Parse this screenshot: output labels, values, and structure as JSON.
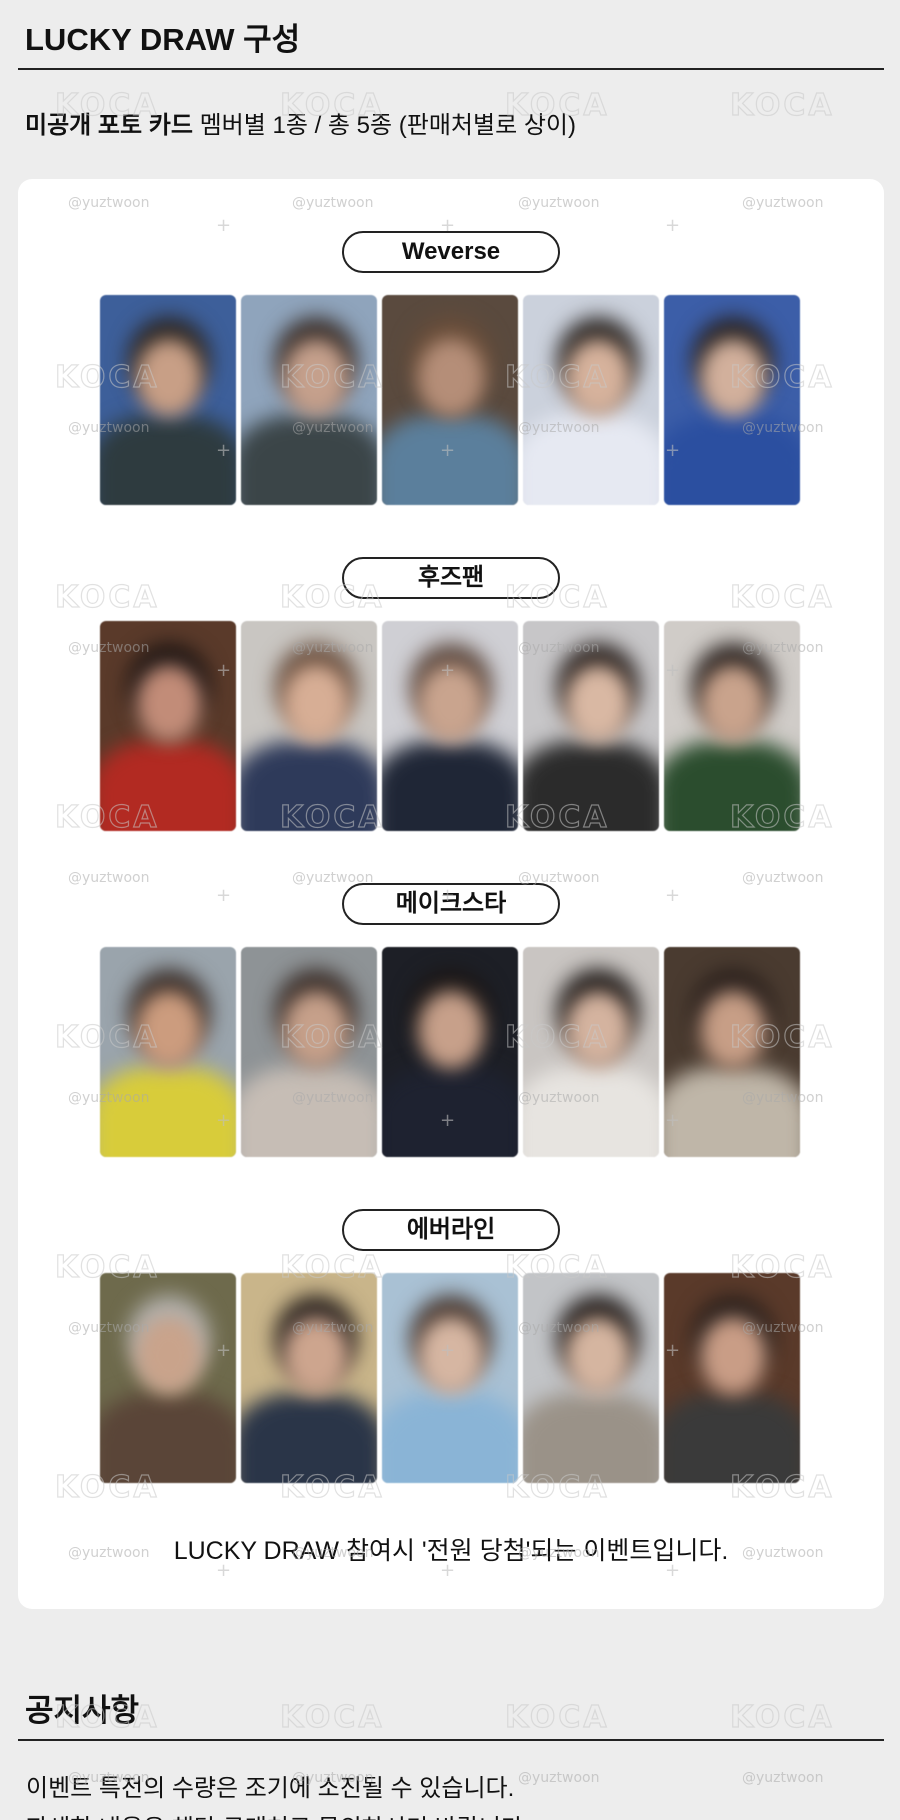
{
  "lucky_draw": {
    "title": "LUCKY DRAW 구성",
    "subtitle_bold": "미공개 포토 카드",
    "subtitle_rest": " 멤버별 1종 / 총 5종 (판매처별로 상이)"
  },
  "groups": [
    {
      "label": "Weverse"
    },
    {
      "label": "후즈팬"
    },
    {
      "label": "메이크스타"
    },
    {
      "label": "에버라인"
    }
  ],
  "lucky_draw_note": "LUCKY DRAW 참여시 '전원 당첨'되는 이벤트입니다.",
  "notice": {
    "title": "공지사항",
    "lines": [
      "이벤트 특전의 수량은 조기에 소진될 수 있습니다.",
      "자세한 내용은 해당 구매처로 문의하시기 바랍니다."
    ]
  },
  "watermarks": {
    "logo": "KOCA",
    "handle": "@yuztwoon"
  }
}
